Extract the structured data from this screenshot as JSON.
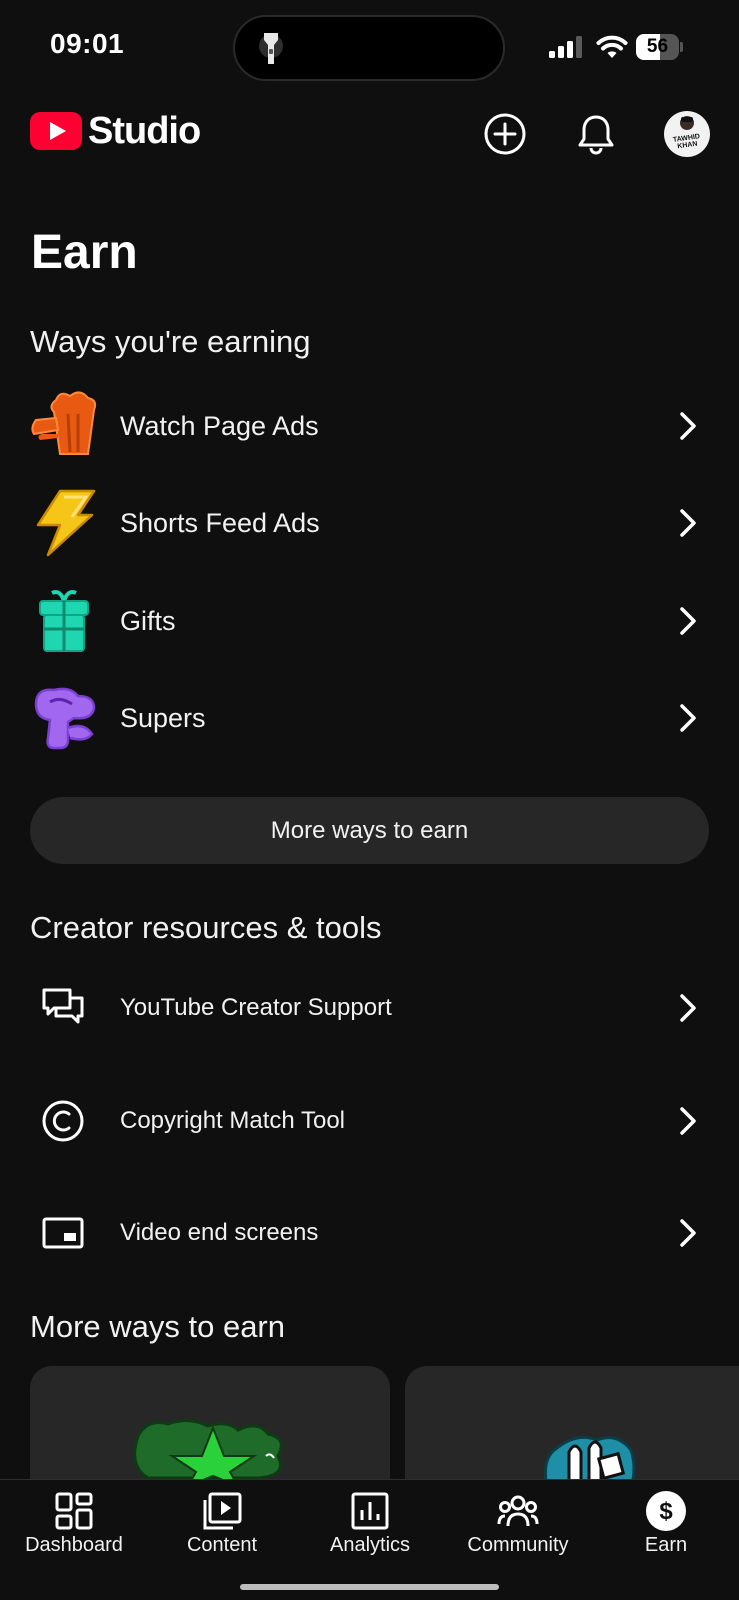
{
  "status_bar": {
    "time": "09:01",
    "battery_level": "56"
  },
  "header": {
    "brand": "Studio",
    "avatar_text": "TAWHID KHAN"
  },
  "page_title": "Earn",
  "ways_earning": {
    "title": "Ways you're earning",
    "items": [
      {
        "label": "Watch Page Ads",
        "icon": "popcorn-icon"
      },
      {
        "label": "Shorts Feed Ads",
        "icon": "lightning-icon"
      },
      {
        "label": "Gifts",
        "icon": "gift-icon"
      },
      {
        "label": "Supers",
        "icon": "supers-icon"
      }
    ],
    "more_button": "More ways to earn"
  },
  "creator_resources": {
    "title": "Creator resources & tools",
    "items": [
      {
        "label": "YouTube Creator Support",
        "icon": "chat-bubbles-icon"
      },
      {
        "label": "Copyright Match Tool",
        "icon": "copyright-icon"
      },
      {
        "label": "Video end screens",
        "icon": "end-screen-icon"
      }
    ]
  },
  "more_ways": {
    "title": "More ways to earn"
  },
  "bottom_nav": [
    {
      "label": "Dashboard",
      "icon": "dashboard-icon"
    },
    {
      "label": "Content",
      "icon": "content-icon"
    },
    {
      "label": "Analytics",
      "icon": "analytics-icon"
    },
    {
      "label": "Community",
      "icon": "community-icon"
    },
    {
      "label": "Earn",
      "icon": "earn-icon",
      "active": true
    }
  ],
  "colors": {
    "background": "#0f0f0f",
    "surface": "#272727",
    "youtube_red": "#ff0033",
    "popcorn_orange": "#e85a12",
    "lightning_yellow": "#f5c518",
    "gift_teal": "#1ed7b0",
    "supers_purple": "#a267ef"
  }
}
